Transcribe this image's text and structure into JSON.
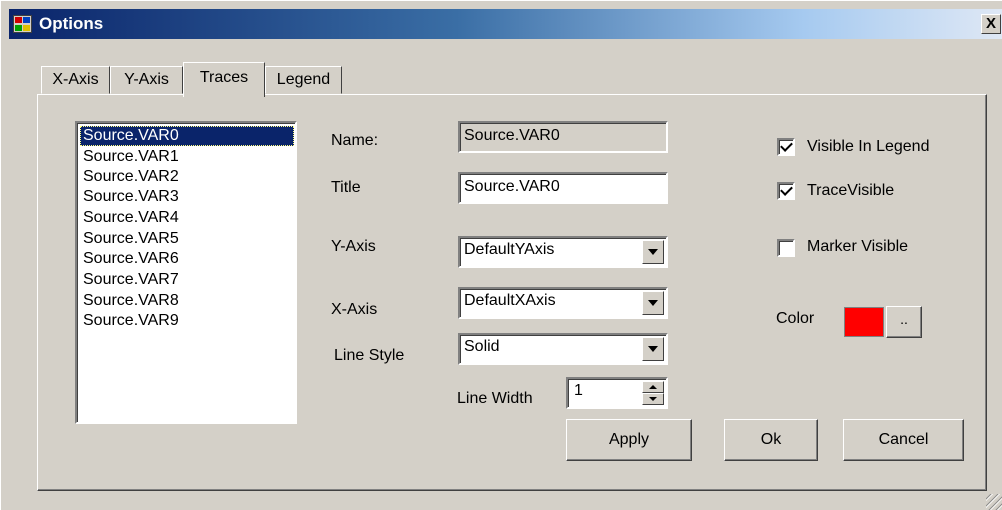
{
  "window": {
    "title": "Options",
    "close_label": "X"
  },
  "tabs": [
    {
      "label": "X-Axis"
    },
    {
      "label": "Y-Axis"
    },
    {
      "label": "Traces",
      "active": true
    },
    {
      "label": "Legend"
    }
  ],
  "traces": {
    "items": [
      "Source.VAR0",
      "Source.VAR1",
      "Source.VAR2",
      "Source.VAR3",
      "Source.VAR4",
      "Source.VAR5",
      "Source.VAR6",
      "Source.VAR7",
      "Source.VAR8",
      "Source.VAR9"
    ],
    "selected_index": 0
  },
  "form": {
    "name_label": "Name:",
    "name_value": "Source.VAR0",
    "title_label": "Title",
    "title_value": "Source.VAR0",
    "yaxis_label": "Y-Axis",
    "yaxis_value": "DefaultYAxis",
    "xaxis_label": "X-Axis",
    "xaxis_value": "DefaultXAxis",
    "linestyle_label": "Line Style",
    "linestyle_value": "Solid",
    "linewidth_label": "Line Width",
    "linewidth_value": "1"
  },
  "options": {
    "visible_in_legend": {
      "label": "Visible In Legend",
      "checked": true
    },
    "trace_visible": {
      "label": "TraceVisible",
      "checked": true
    },
    "marker_visible": {
      "label": "Marker Visible",
      "checked": false
    },
    "color_label": "Color",
    "color_value": "#ff0000",
    "color_button_label": ".."
  },
  "buttons": {
    "apply": "Apply",
    "ok": "Ok",
    "cancel": "Cancel"
  }
}
